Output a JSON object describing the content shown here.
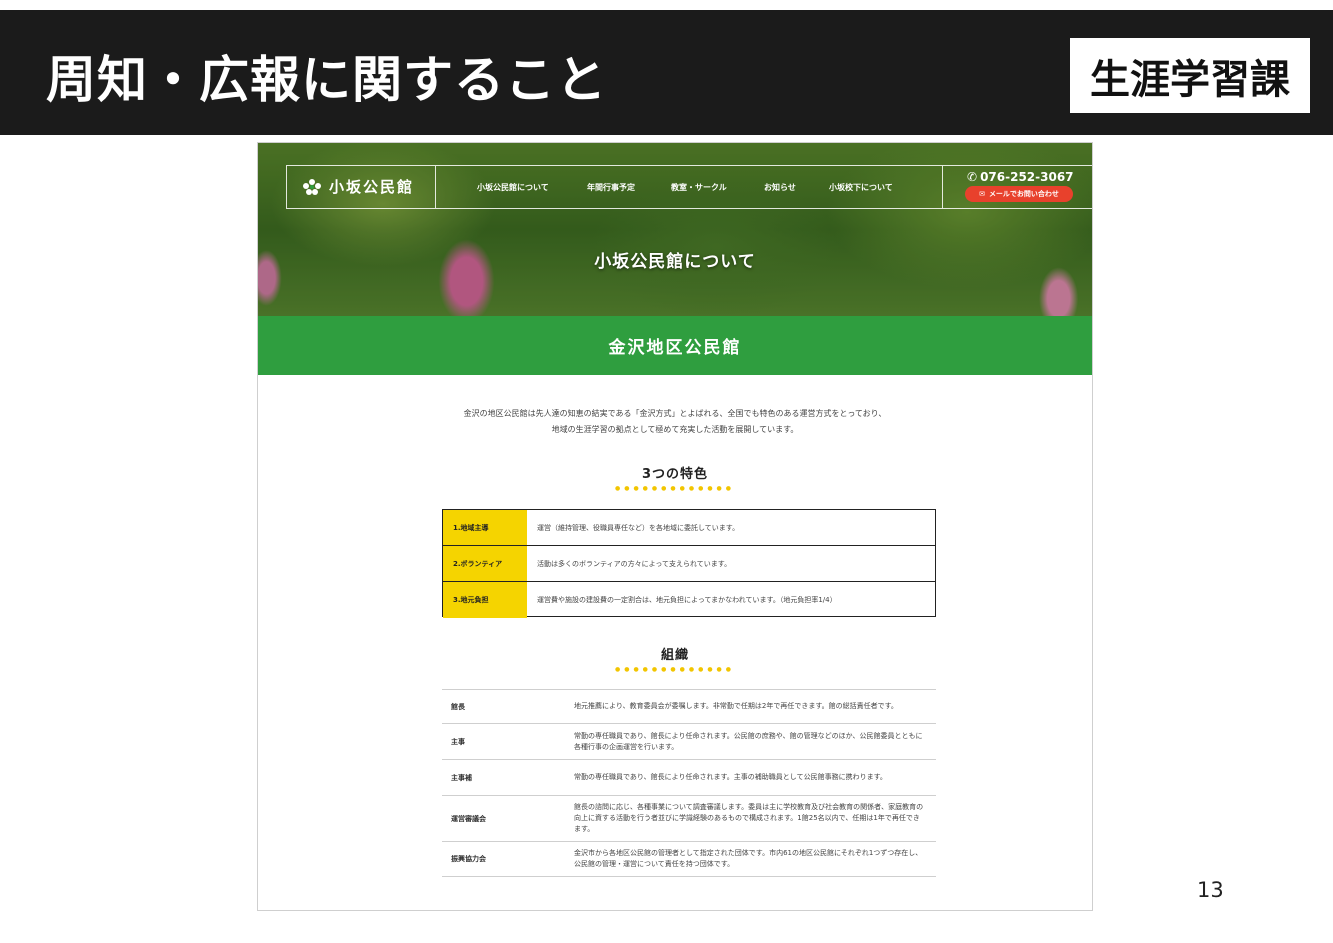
{
  "slide": {
    "title": "周知・広報に関すること",
    "department": "生涯学習課",
    "page_number": "13"
  },
  "site": {
    "logo_text": "小坂公民館",
    "nav": [
      "小坂公民館について",
      "年間行事予定",
      "教室・サークル",
      "お知らせ",
      "小坂校下について"
    ],
    "phone": "076-252-3067",
    "mail_button": "メールでお問い合わせ",
    "hero_title": "小坂公民館について",
    "band_title": "金沢地区公民館",
    "intro_lines": [
      "金沢の地区公民館は先人達の知恵の結実である「金沢方式」とよばれる、全国でも特色のある運営方式をとっており、",
      "地域の生涯学習の拠点として極めて充実した活動を展開しています。"
    ],
    "features_heading": "3つの特色",
    "features": [
      {
        "label": "1.地域主導",
        "desc": "運営（維持管理、役職員専任など）を各地域に委託しています。"
      },
      {
        "label": "2.ボランティア",
        "desc": "活動は多くのボランティアの方々によって支えられています。"
      },
      {
        "label": "3.地元負担",
        "desc": "運営費や施設の建設費の一定割合は、地元負担によってまかなわれています。（地元負担率1/4）"
      }
    ],
    "org_heading": "組織",
    "org": [
      {
        "label": "館長",
        "desc": "地元推薦により、教育委員会が委嘱します。非常勤で任期は2年で再任できます。館の総括責任者です。"
      },
      {
        "label": "主事",
        "desc": "常勤の専任職員であり、館長により任命されます。公民館の庶務や、館の管理などのほか、公民館委員とともに各種行事の企画運営を行います。"
      },
      {
        "label": "主事補",
        "desc": "常勤の専任職員であり、館長により任命されます。主事の補助職員として公民館事務に携わります。"
      },
      {
        "label": "運営審議会",
        "desc": "館長の諮問に応じ、各種事業について調査審議します。委員は主に学校教育及び社会教育の関係者、家庭教育の向上に資する活動を行う者並びに学識経験のあるもので構成されます。1館25名以内で、任期は1年で再任できます。"
      },
      {
        "label": "振興協力会",
        "desc": "金沢市から各地区公民館の管理者として指定された団体です。市内61の地区公民館にそれぞれ1つずつ存在し、公民館の管理・運営について責任を持つ団体です。"
      }
    ],
    "colors": {
      "green_band": "#2f9e3f",
      "feature_yellow": "#f5d400",
      "mail_red": "#e8412c",
      "dots": "#f2c500"
    }
  }
}
